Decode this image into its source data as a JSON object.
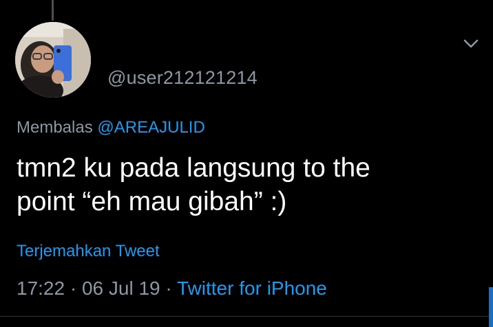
{
  "tweet": {
    "handle": "@user212121214",
    "reply_prefix": "Membalas",
    "reply_mention": "@AREAJULID",
    "text_line1": "tmn2 ku pada langsung to the",
    "text_line2": "point “eh mau gibah” :)",
    "translate_label": "Terjemahkan Tweet",
    "time": "17:22",
    "separator": " · ",
    "date": "06 Jul 19",
    "source": "Twitter for iPhone"
  },
  "icons": {
    "avatar": "profile-photo",
    "caret": "chevron-down-icon"
  },
  "colors": {
    "background": "#000000",
    "text": "#ffffff",
    "secondary": "#8b98a5",
    "accent": "#1d9bf0"
  }
}
